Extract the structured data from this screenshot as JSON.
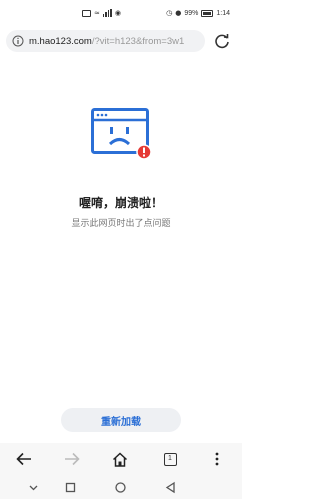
{
  "status_bar": {
    "left_icons": [
      "hd-icon",
      "wifi-icon",
      "signal-icon",
      "network-icon"
    ],
    "battery_percent": "99%",
    "time": "1:14"
  },
  "address_bar": {
    "url_host": "m.hao123.com",
    "url_path": "/?vit=h123&from=3w1"
  },
  "error": {
    "title": "喔唷，崩溃啦！",
    "message": "显示此网页时出了点问题"
  },
  "reload_label": "重新加载",
  "toolbar": {
    "tab_count": "1"
  },
  "colors": {
    "accent": "#2b6fd6",
    "error_badge": "#e53935"
  }
}
